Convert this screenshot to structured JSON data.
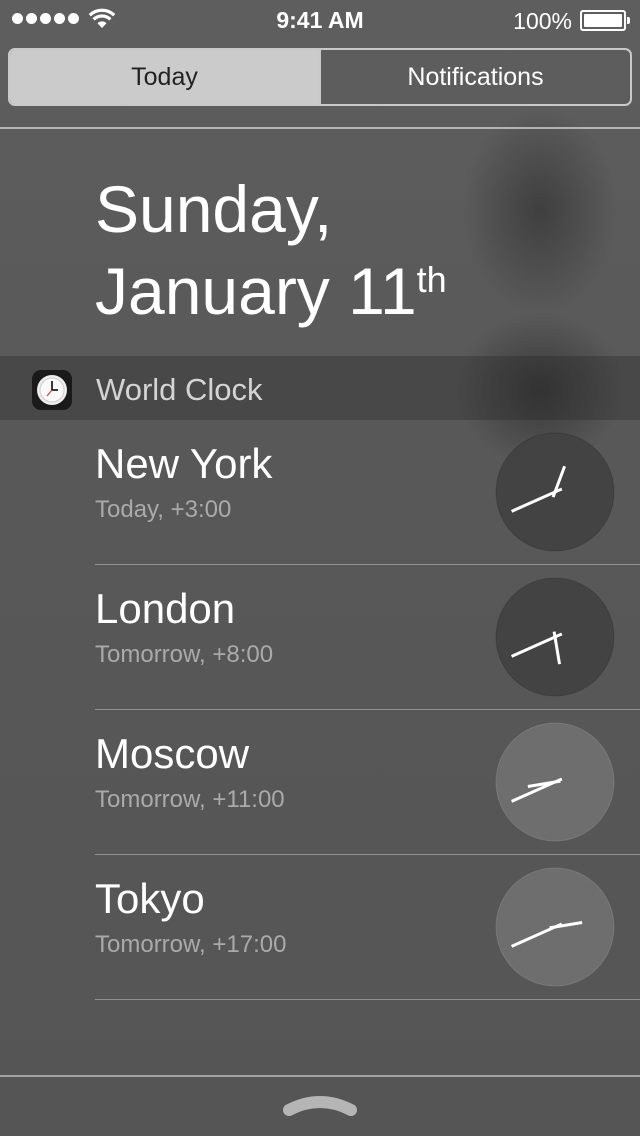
{
  "status_bar": {
    "time": "9:41 AM",
    "battery_percent": "100%",
    "signal_bars": 5,
    "wifi_icon": "wifi-icon",
    "battery_level": 1.0
  },
  "segmented_control": {
    "tabs": [
      {
        "label": "Today",
        "selected": true
      },
      {
        "label": "Notifications",
        "selected": false
      }
    ]
  },
  "date": {
    "weekday": "Sunday,",
    "month_day": "January 11",
    "ordinal_suffix": "th"
  },
  "world_clock": {
    "header": "World Clock",
    "icon": "world-clock-app-icon",
    "cities": [
      {
        "name": "New York",
        "offset": "Today, +3:00",
        "night": true,
        "hour": 12,
        "minute": 41
      },
      {
        "name": "London",
        "offset": "Tomorrow, +8:00",
        "night": true,
        "hour": 17,
        "minute": 41
      },
      {
        "name": "Moscow",
        "offset": "Tomorrow, +11:00",
        "night": false,
        "hour": 20,
        "minute": 41
      },
      {
        "name": "Tokyo",
        "offset": "Tomorrow, +17:00",
        "night": false,
        "hour": 2,
        "minute": 41
      }
    ]
  },
  "colors": {
    "night_dial": "#434343",
    "day_dial": "#6e6e6e",
    "selected_segment": "#cbcbcb"
  },
  "grabber_icon": "chevron-up-grabber-icon"
}
